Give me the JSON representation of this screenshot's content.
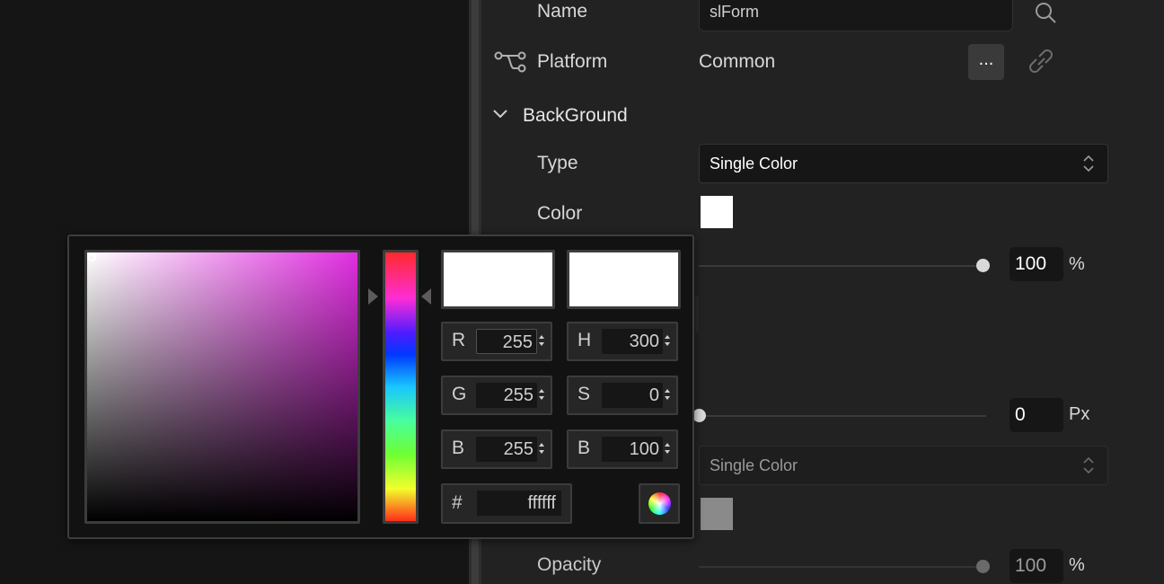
{
  "properties": {
    "name_label": "Name",
    "name_value": "slForm",
    "platform_label": "Platform",
    "platform_value": "Common",
    "platform_button": "...",
    "background_section": "BackGround",
    "type_label": "Type",
    "type_value": "Single Color",
    "color_label": "Color",
    "opacity_value": "100",
    "opacity_unit": "%",
    "border_value": "0",
    "border_unit": "Px",
    "type2_value": "Single Color",
    "opacity2_label": "Opacity",
    "opacity2_value": "100",
    "opacity2_unit": "%",
    "color_swatch": "#ffffff",
    "color2_swatch": "#8a8a8a",
    "opacity_fraction": 1.0,
    "border_fraction": 0.0,
    "opacity2_fraction": 1.0
  },
  "color_picker": {
    "hue_color": "#e12ee1",
    "new_color": "#ffffff",
    "old_color": "#ffffff",
    "rgb": [
      {
        "key": "R",
        "value": "255"
      },
      {
        "key": "G",
        "value": "255"
      },
      {
        "key": "B",
        "value": "255"
      }
    ],
    "hsb": [
      {
        "key": "H",
        "value": "300"
      },
      {
        "key": "S",
        "value": "0"
      },
      {
        "key": "B",
        "value": "100"
      }
    ],
    "hex_key": "#",
    "hex_value": "ffffff"
  },
  "icons": [
    "search-icon",
    "platform-branch-icon",
    "link-icon",
    "chevron-down-icon",
    "color-wheel-icon"
  ]
}
